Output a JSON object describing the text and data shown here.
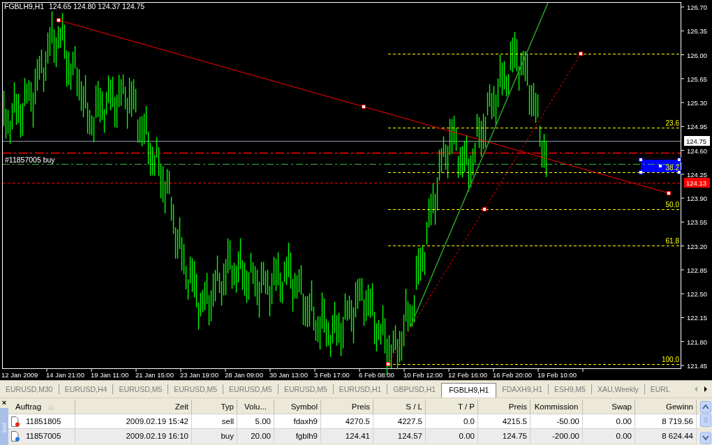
{
  "chart": {
    "symbol": "FGBLH9,H1",
    "ohlc": "124.65 124.80 124.37 124.75",
    "price_labels": [
      "126.70",
      "126.35",
      "126.00",
      "125.65",
      "125.30",
      "124.95",
      "124.60",
      "124.25",
      "123.90",
      "123.55",
      "123.20",
      "122.85",
      "122.50",
      "122.15",
      "121.80",
      "121.45"
    ],
    "time_labels": [
      "12 Jan 2009",
      "14 Jan 21:00",
      "19 Jan 11:00",
      "21 Jan 15:00",
      "23 Jan 19:00",
      "28 Jan 09:00",
      "30 Jan 13:00",
      "3 Feb 17:00",
      "6 Feb 08:00",
      "10 Feb 12:00",
      "12 Feb 16:00",
      "16 Feb 20:00",
      "19 Feb 10:00"
    ],
    "bid_label": "124.75",
    "ask_label": "124.13",
    "order_label": "#11857005 buy",
    "fib_labels": [
      "23.6",
      "38.2",
      "50.0",
      "61.8",
      "100.0"
    ]
  },
  "tabs": [
    {
      "label": "EURUSD,M30",
      "selected": false
    },
    {
      "label": "EURUSD,H4",
      "selected": false
    },
    {
      "label": "EURUSD,M5",
      "selected": false
    },
    {
      "label": "EURUSD,M5",
      "selected": false
    },
    {
      "label": "EURUSD,M5",
      "selected": false
    },
    {
      "label": "EURUSD,M5",
      "selected": false
    },
    {
      "label": "EURUSD,H1",
      "selected": false
    },
    {
      "label": "GBPUSD,H1",
      "selected": false
    },
    {
      "label": "FGBLH9,H1",
      "selected": true
    },
    {
      "label": "FDAXH9,H1",
      "selected": false
    },
    {
      "label": "ESH9,M5",
      "selected": false
    },
    {
      "label": "XAU,Weekly",
      "selected": false
    },
    {
      "label": "EURL",
      "selected": false
    }
  ],
  "terminal": {
    "close": "×",
    "side_label": "inal",
    "columns": [
      "Auftrag",
      "Zeit",
      "Typ",
      "Volu...",
      "Symbol",
      "Preis",
      "S / L",
      "T / P",
      "Preis",
      "Kommission",
      "Swap",
      "Gewinn"
    ],
    "rows": [
      {
        "kind": "sell",
        "cells": [
          "11851805",
          "2009.02.19 15:42",
          "sell",
          "5.00",
          "fdaxh9",
          "4270.5",
          "4227.5",
          "0.0",
          "4215.5",
          "-50.00",
          "0.00",
          "8 719.56"
        ]
      },
      {
        "kind": "buy",
        "cells": [
          "11857005",
          "2009.02.19 16:10",
          "buy",
          "20.00",
          "fgblh9",
          "124.41",
          "124.57",
          "0.00",
          "124.75",
          "-200.00",
          "0.00",
          "8 624.44"
        ]
      }
    ]
  }
}
